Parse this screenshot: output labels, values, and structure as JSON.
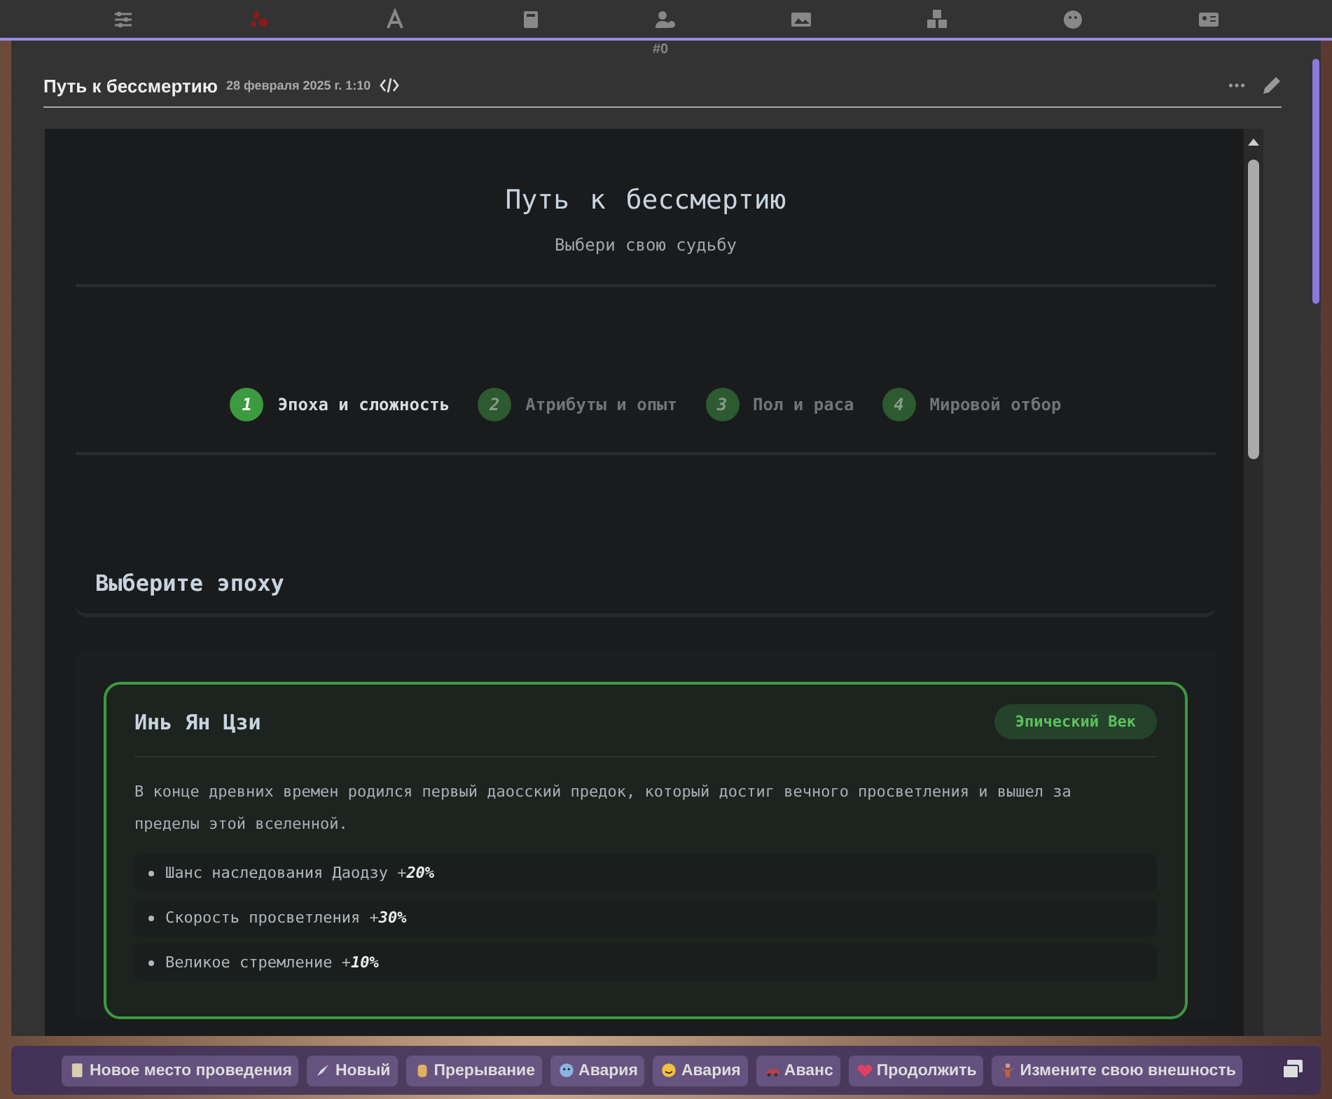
{
  "top_bar": {
    "counter": "#0"
  },
  "message": {
    "title": "Путь к бессмертию",
    "date": "28 февраля 2025 г. 1:10"
  },
  "page": {
    "title": "Путь к бессмертию",
    "subtitle": "Выбери свою судьбу",
    "steps": [
      {
        "number": "1",
        "label": "Эпоха и сложность",
        "selected": true
      },
      {
        "number": "2",
        "label": "Атрибуты и опыт",
        "selected": false
      },
      {
        "number": "3",
        "label": "Пол и раса",
        "selected": false
      },
      {
        "number": "4",
        "label": "Мировой отбор",
        "selected": false
      }
    ],
    "section_title": "Выберите эпоху",
    "era_card": {
      "title": "Инь Ян Цзи",
      "badge": "Эпический Век",
      "selected": true,
      "description": "В конце древних времен родился первый даосский предок, который достиг вечного просветления и вышел за пределы этой вселенной.",
      "bonuses": [
        "Шанс наследования Даодзу +**20%**",
        "Скорость просветления +**30%**",
        "Великое стремление +**10%**"
      ]
    }
  },
  "quick_replies": [
    "Новое место проведения",
    "Новый",
    "Прерывание",
    "Авария",
    "Авария",
    "Аванс",
    "Продолжить",
    "Измените свою внешность"
  ]
}
